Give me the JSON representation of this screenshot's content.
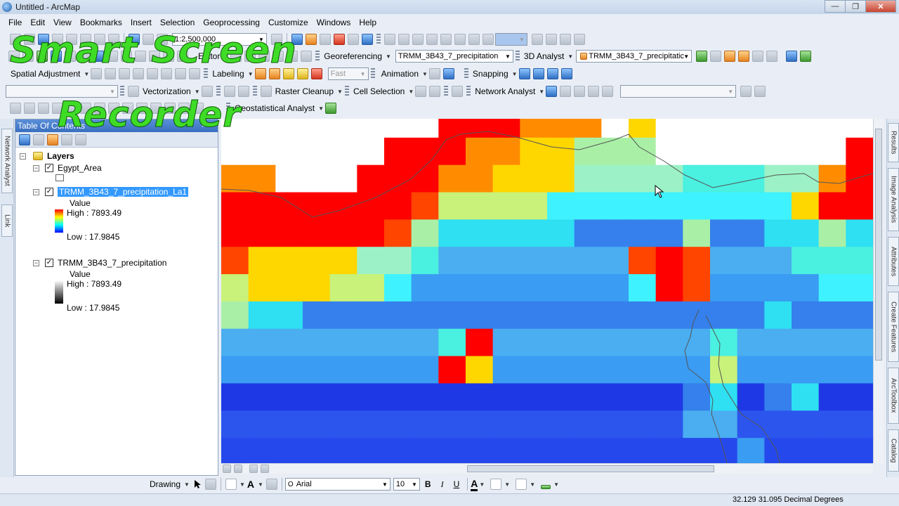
{
  "window": {
    "title": "Untitled - ArcMap",
    "minimize": "—",
    "restore": "❐",
    "close": "✕"
  },
  "menu": [
    "File",
    "Edit",
    "View",
    "Bookmarks",
    "Insert",
    "Selection",
    "Geoprocessing",
    "Customize",
    "Windows",
    "Help"
  ],
  "standard_toolbar": {
    "scale": "1:2,500,000"
  },
  "row2": {
    "editor": "Editor",
    "georeferencing": "Georeferencing",
    "georef_layer": "TRMM_3B43_7_precipitation",
    "analyst3d": "3D Analyst",
    "analyst3d_layer": "TRMM_3B43_7_precipitatic"
  },
  "row3": {
    "spatial_adjustment": "Spatial Adjustment",
    "labeling": "Labeling",
    "label_quality": "Fast",
    "animation": "Animation",
    "snapping": "Snapping"
  },
  "row4": {
    "vectorization": "Vectorization",
    "raster_cleanup": "Raster Cleanup",
    "cell_selection": "Cell Selection",
    "network_analyst": "Network Analyst"
  },
  "row5": {
    "geostatistical": "Geostatistical Analyst"
  },
  "toc": {
    "title": "Table Of Contents",
    "pin": "♯",
    "close": "✕",
    "layers_label": "Layers",
    "egypt_area": "Egypt_Area",
    "layer1": {
      "name": "TRMM_3B43_7_precipitation_La1",
      "value_label": "Value",
      "high": "High : 7893.49",
      "low": "Low : 17.9845"
    },
    "layer2": {
      "name": "TRMM_3B43_7_precipitation",
      "value_label": "Value",
      "high": "High : 7893.49",
      "low": "Low : 17.9845"
    }
  },
  "left_tabs": [
    "Network Analyst",
    "Link"
  ],
  "right_tabs": [
    "Results",
    "Image Analysis",
    "Attributes",
    "Create Features",
    "ArcToolbox",
    "Catalog"
  ],
  "drawing_toolbar": {
    "drawing": "Drawing",
    "font": "Arial",
    "size": "10",
    "bold": "B",
    "italic": "I",
    "underline": "U",
    "font_color": "A"
  },
  "status": {
    "coords": "32.129  31.095 Decimal Degrees"
  },
  "watermark": {
    "line1": "Smart Screen",
    "line2": "Recorder"
  },
  "colors": {
    "selection": "#3399ff",
    "toc_header": "#3a6fc0",
    "raster_ramp": [
      "#ff0000",
      "#ff8000",
      "#ffff00",
      "#00ffff",
      "#0000ff"
    ]
  },
  "raster": {
    "columns": 24,
    "rows": 13,
    "grid": [
      "WWWWWWWWRRROOOWYWWWWWWWW",
      "WWWWWWRRROOYYLLLWWWWWWWR",
      "OOWWWRRROOYYYLLLLCCCLLOR",
      "RRRRRRRoLLLLCCCCCCCCCYRR",
      "RRRRRRoLCCCCCSSSSLSSCCLC",
      "oYYYYLLCSSSSSSSoRoSSSCCC",
      "LYYYLLCSSSSSSSSCRoSSSSCC",
      "LCCSSSSSSSSSSSSSSSSSCSSS",
      "SSSSSSSSCRSSSSSSSSCSSSSS",
      "SSSSSSSSRYSSSSSSSSLSSSSS",
      "BBBBBBBBBBBBBBBBBSCBSCBB",
      "BBBBBBBBBBBBBBBBBSSBBBBB",
      "BBBBBBBBBBBBBBBBBBBSBBBB"
    ]
  }
}
